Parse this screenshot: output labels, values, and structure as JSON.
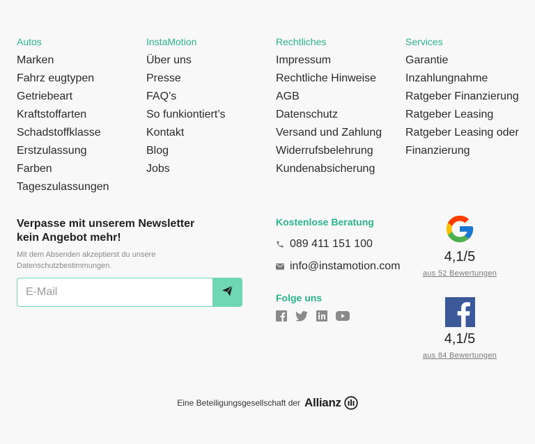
{
  "columns": [
    {
      "title": "Autos",
      "items": [
        "Marken",
        "Fahrz eugtypen",
        "Getriebeart",
        "Kraftstoffarten",
        "Schadstoffklasse",
        "Erstzulassung",
        "Farben",
        "Tageszulassungen"
      ]
    },
    {
      "title": "InstaMotion",
      "items": [
        "Über uns",
        "Presse",
        "FAQ’s",
        "So funkiontiert’s",
        "Kontakt",
        "Blog",
        "Jobs"
      ]
    },
    {
      "title": "Rechtliches",
      "items": [
        "Impressum",
        "Rechtliche Hinweise",
        "AGB",
        "Datenschutz",
        "Versand und Zahlung",
        "Widerrufsbelehrung",
        "Kundenabsicherung"
      ]
    },
    {
      "title": "Services",
      "items": [
        "Garantie",
        "Inzahlungnahme",
        "Ratgeber Finanzierung",
        "Ratgeber Leasing",
        "Ratgeber Leasing oder Finanzierung"
      ]
    }
  ],
  "newsletter": {
    "title": "Verpasse mit unserem Newsletter kein Angebot mehr!",
    "subtitle": "Mit dem Absenden akzeptierst du unsere Datenschutzbestimmungen.",
    "placeholder": "E-Mail"
  },
  "contact": {
    "title": "Kostenlose Beratung",
    "phone": "089 411 151 100",
    "email": "info@instamotion.com"
  },
  "follow": {
    "title": "Folge uns",
    "icons": [
      "facebook-icon",
      "twitter-icon",
      "linkedin-icon",
      "youtube-icon"
    ]
  },
  "ratings": [
    {
      "platform_icon": "google-icon",
      "score": "4,1/5",
      "count": "aus 52 Bewertungen"
    },
    {
      "platform_icon": "facebook-icon",
      "score": "4,1/5",
      "count": "aus 84 Bewertungen"
    }
  ],
  "footer": {
    "text": "Eine Beteiligungsgesellschaft der",
    "brand": "Allianz"
  },
  "colors": {
    "accent": "#2bb38b",
    "button": "#70d7b5",
    "facebook": "#3b5998"
  }
}
